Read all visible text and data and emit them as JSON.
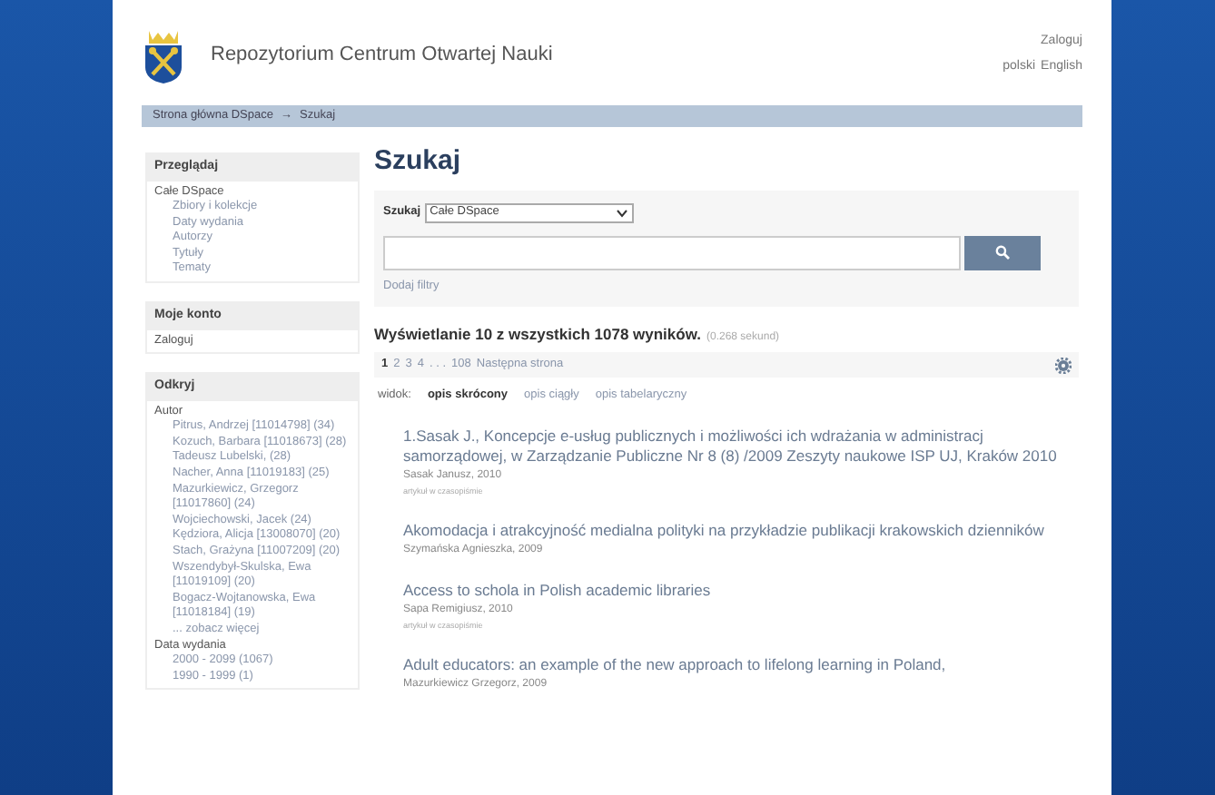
{
  "header": {
    "title": "Repozytorium Centrum Otwartej Nauki",
    "login": "Zaloguj",
    "languages": [
      "polski",
      "English"
    ]
  },
  "breadcrumb": [
    "Strona główna DSpace",
    "→",
    "Szukaj"
  ],
  "sidebar": [
    {
      "title": "Przeglądaj",
      "items": [
        {
          "label": "Całe DSpace",
          "children": [
            {
              "label": "Zbiory i kolekcje"
            },
            {
              "label": "Daty wydania"
            },
            {
              "label": "Autorzy"
            },
            {
              "label": "Tytuły"
            },
            {
              "label": "Tematy"
            }
          ]
        }
      ]
    },
    {
      "title": "Moje konto",
      "items": [
        {
          "label": "Zaloguj"
        }
      ]
    },
    {
      "title": "Odkryj",
      "items": [
        {
          "label": "Autor",
          "children": [
            {
              "label": "Pitrus, Andrzej [11014798] (34)"
            },
            {
              "label": "Kozuch, Barbara [11018673] (28)"
            },
            {
              "label": "Tadeusz Lubelski, (28)"
            },
            {
              "label": "Nacher, Anna [11019183] (25)"
            },
            {
              "label": "Mazurkiewicz, Grzegorz [11017860] (24)"
            },
            {
              "label": "Wojciechowski, Jacek (24)"
            },
            {
              "label": "Kędziora, Alicja [13008070] (20)"
            },
            {
              "label": "Stach, Grażyna [11007209] (20)"
            },
            {
              "label": "Wszendybył-Skulska, Ewa [11019109] (20)"
            },
            {
              "label": "Bogacz-Wojtanowska, Ewa [11018184] (19)"
            },
            {
              "label": "... zobacz więcej"
            }
          ]
        },
        {
          "label": "Data wydania",
          "children": [
            {
              "label": "2000 - 2099 (1067)"
            },
            {
              "label": "1990 - 1999 (1)"
            }
          ]
        }
      ]
    }
  ],
  "main": {
    "heading": "Szukaj",
    "search": {
      "scope_label": "Szukaj",
      "scope": "Całe DSpace",
      "add_filters": "Dodaj filtry"
    },
    "summary": "Wyświetlanie 10 z wszystkich 1078 wyników.",
    "time": "(0.268 sekund)",
    "pagination": [
      {
        "label": "1",
        "selected": true
      },
      {
        "label": "2",
        "selected": false
      },
      {
        "label": "3",
        "selected": false
      },
      {
        "label": "4",
        "selected": false
      },
      {
        "label": ". . .",
        "selected": false
      },
      {
        "label": "108",
        "selected": false
      },
      {
        "label": "Następna strona",
        "selected": false
      }
    ],
    "view": {
      "label": "widok:",
      "options": [
        {
          "label": "opis skrócony",
          "selected": true
        },
        {
          "label": "opis ciągły",
          "selected": false
        },
        {
          "label": "opis tabelaryczny",
          "selected": false
        }
      ]
    },
    "results": [
      {
        "title": "1.Sasak J., Koncepcje e-usług publicznych i możliwości ich wdrażania w administracj samorządowej, w Zarządzanie Publiczne Nr 8 (8) /2009 Zeszyty naukowe ISP UJ, Kraków 2010",
        "author": "Sasak Janusz, 2010",
        "type": "artykuł w czasopiśmie"
      },
      {
        "title": "Akomodacja i atrakcyjność medialna polityki na przykładzie publikacji krakowskich dzienników",
        "author": "Szymańska Agnieszka, 2009"
      },
      {
        "title": "Access to schola in Polish academic libraries",
        "author": "Sapa Remigiusz, 2010",
        "type": "artykuł w czasopiśmie"
      },
      {
        "title": "Adult educators: an example of the new approach to lifelong learning in Poland,",
        "author": "Mazurkiewicz Grzegorz, 2009"
      }
    ]
  }
}
